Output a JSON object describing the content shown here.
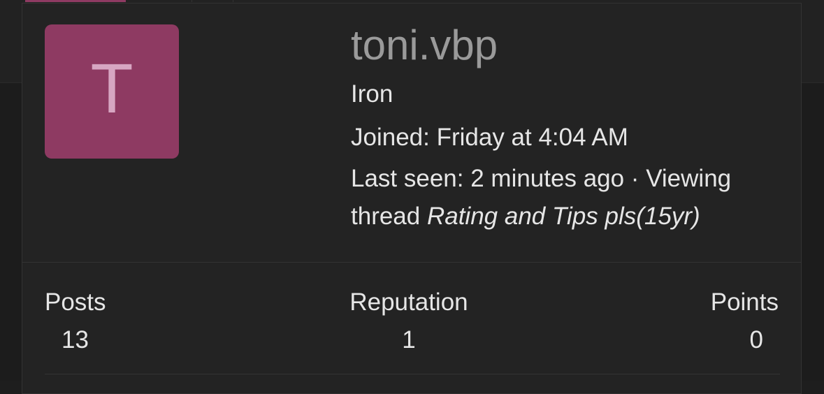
{
  "profile": {
    "avatar_letter": "T",
    "username": "toni.vbp",
    "rank": "Iron",
    "joined": "Joined: Friday at 4:04 AM",
    "last_seen_prefix": "Last seen: 2 minutes ago · Viewing thread ",
    "last_seen_thread": "Rating and Tips pls(15yr)"
  },
  "stats": [
    {
      "label": "Posts",
      "value": "13"
    },
    {
      "label": "Reputation",
      "value": "1"
    },
    {
      "label": "Points",
      "value": "0"
    }
  ],
  "colors": {
    "avatar_bg": "#8e3a62",
    "avatar_letter": "#d7a6c2",
    "username": "#9a9a9a",
    "text": "#e6e6e6",
    "card_bg": "#232323"
  }
}
